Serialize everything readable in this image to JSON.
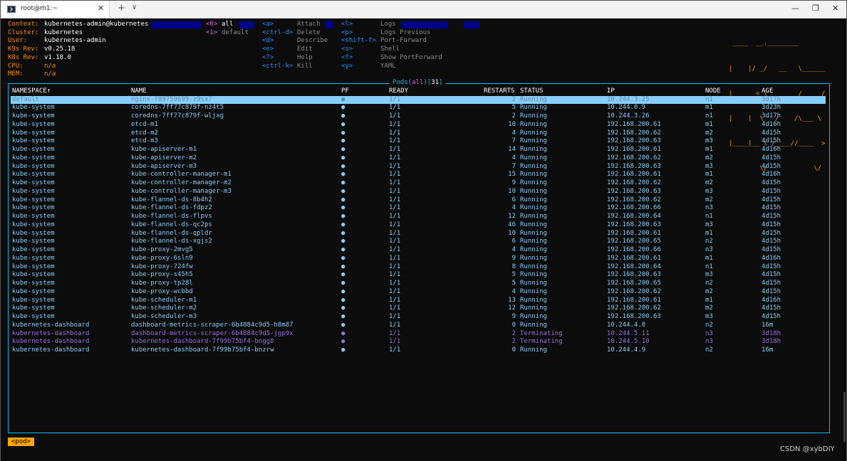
{
  "window": {
    "tab_title": "root@m1:~",
    "tab_close": "✕",
    "new_tab": "+",
    "dropdown": "∨",
    "minimize": "—",
    "maximize": "❐",
    "close": "✕"
  },
  "info": {
    "context_label": "Context:",
    "context_value": "kubernetes-admin@kubernetes",
    "cluster_label": "Cluster:",
    "cluster_value": "kubernetes",
    "user_label": "User:",
    "user_value": "kubernetes-admin",
    "k9s_label": "K9s Rev:",
    "k9s_value": "v0.25.18",
    "k8s_label": "K8s Rev:",
    "k8s_value": "v1.18.0",
    "cpu_label": "CPU:",
    "cpu_value": "n/a",
    "mem_label": "MEM:",
    "mem_value": "n/a"
  },
  "namespaces": [
    {
      "key": "<0>",
      "label": "all"
    },
    {
      "key": "<1>",
      "label": "default"
    }
  ],
  "shortcuts_col1": [
    {
      "key": "<a>",
      "label": "Attach"
    },
    {
      "key": "<ctrl-d>",
      "label": "Delete"
    },
    {
      "key": "<d>",
      "label": "Describe"
    },
    {
      "key": "<e>",
      "label": "Edit"
    },
    {
      "key": "<?>",
      "label": "Help"
    },
    {
      "key": "<ctrl-k>",
      "label": "Kill"
    }
  ],
  "shortcuts_col2": [
    {
      "key": "<l>",
      "label": "Logs"
    },
    {
      "key": "<p>",
      "label": "Logs Previous"
    },
    {
      "key": "<shift-f>",
      "label": "Port-Forward"
    },
    {
      "key": "<s>",
      "label": "Shell"
    },
    {
      "key": "<f>",
      "label": "Show PortForward"
    },
    {
      "key": "<y>",
      "label": "YAML"
    }
  ],
  "logo_lines": [
    " ____  __.________       ",
    "|    |/ _/   __   \\______",
    "|      < \\____    /  ___/",
    "|    |  \\   /    /\\___ \\ ",
    "|____|__ \\ /____//____  >",
    "        \\/            \\/ "
  ],
  "pods": {
    "title_prefix": "Pods(",
    "title_ns": "all",
    "title_mid": ")[",
    "title_count": "31",
    "title_suffix": "]",
    "columns": [
      "NAMESPACE↑",
      "NAME",
      "PF",
      "READY",
      "RESTARTS",
      "STATUS",
      "IP",
      "NODE",
      "AGE"
    ],
    "rows": [
      {
        "ns": "default",
        "name": "nginx-f89759699-z9sx7",
        "pf": "●",
        "ready": "1/1",
        "restarts": "2",
        "status": "Running",
        "ip": "10.244.3.25",
        "node": "n1",
        "age": "3d17h",
        "state": "selected"
      },
      {
        "ns": "kube-system",
        "name": "coredns-7ff77c879f-nz4t5",
        "pf": "●",
        "ready": "1/1",
        "restarts": "5",
        "status": "Running",
        "ip": "10.244.0.9",
        "node": "m1",
        "age": "3d23h",
        "state": "running"
      },
      {
        "ns": "kube-system",
        "name": "coredns-7ff77c879f-wljxg",
        "pf": "●",
        "ready": "1/1",
        "restarts": "2",
        "status": "Running",
        "ip": "10.244.3.26",
        "node": "n1",
        "age": "3d17h",
        "state": "running"
      },
      {
        "ns": "kube-system",
        "name": "etcd-m1",
        "pf": "●",
        "ready": "1/1",
        "restarts": "10",
        "status": "Running",
        "ip": "192.168.200.61",
        "node": "m1",
        "age": "4d16h",
        "state": "running"
      },
      {
        "ns": "kube-system",
        "name": "etcd-m2",
        "pf": "●",
        "ready": "1/1",
        "restarts": "4",
        "status": "Running",
        "ip": "192.168.200.62",
        "node": "m2",
        "age": "4d15h",
        "state": "running"
      },
      {
        "ns": "kube-system",
        "name": "etcd-m3",
        "pf": "●",
        "ready": "1/1",
        "restarts": "7",
        "status": "Running",
        "ip": "192.168.200.63",
        "node": "m3",
        "age": "4d15h",
        "state": "running"
      },
      {
        "ns": "kube-system",
        "name": "kube-apiserver-m1",
        "pf": "●",
        "ready": "1/1",
        "restarts": "14",
        "status": "Running",
        "ip": "192.168.200.61",
        "node": "m1",
        "age": "4d16h",
        "state": "running"
      },
      {
        "ns": "kube-system",
        "name": "kube-apiserver-m2",
        "pf": "●",
        "ready": "1/1",
        "restarts": "4",
        "status": "Running",
        "ip": "192.168.200.62",
        "node": "m2",
        "age": "4d15h",
        "state": "running"
      },
      {
        "ns": "kube-system",
        "name": "kube-apiserver-m3",
        "pf": "●",
        "ready": "1/1",
        "restarts": "7",
        "status": "Running",
        "ip": "192.168.200.63",
        "node": "m3",
        "age": "4d15h",
        "state": "running"
      },
      {
        "ns": "kube-system",
        "name": "kube-controller-manager-m1",
        "pf": "●",
        "ready": "1/1",
        "restarts": "15",
        "status": "Running",
        "ip": "192.168.200.61",
        "node": "m1",
        "age": "4d16h",
        "state": "running"
      },
      {
        "ns": "kube-system",
        "name": "kube-controller-manager-m2",
        "pf": "●",
        "ready": "1/1",
        "restarts": "9",
        "status": "Running",
        "ip": "192.168.200.62",
        "node": "m2",
        "age": "4d15h",
        "state": "running"
      },
      {
        "ns": "kube-system",
        "name": "kube-controller-manager-m3",
        "pf": "●",
        "ready": "1/1",
        "restarts": "10",
        "status": "Running",
        "ip": "192.168.200.63",
        "node": "m3",
        "age": "4d15h",
        "state": "running"
      },
      {
        "ns": "kube-system",
        "name": "kube-flannel-ds-8b4h2",
        "pf": "●",
        "ready": "1/1",
        "restarts": "6",
        "status": "Running",
        "ip": "192.168.200.62",
        "node": "m2",
        "age": "4d15h",
        "state": "running"
      },
      {
        "ns": "kube-system",
        "name": "kube-flannel-ds-fdpz2",
        "pf": "●",
        "ready": "1/1",
        "restarts": "4",
        "status": "Running",
        "ip": "192.168.200.66",
        "node": "n3",
        "age": "4d15h",
        "state": "running"
      },
      {
        "ns": "kube-system",
        "name": "kube-flannel-ds-flpvs",
        "pf": "●",
        "ready": "1/1",
        "restarts": "12",
        "status": "Running",
        "ip": "192.168.200.64",
        "node": "n1",
        "age": "4d15h",
        "state": "running"
      },
      {
        "ns": "kube-system",
        "name": "kube-flannel-ds-qc2ps",
        "pf": "●",
        "ready": "1/1",
        "restarts": "46",
        "status": "Running",
        "ip": "192.168.200.63",
        "node": "m3",
        "age": "4d15h",
        "state": "running"
      },
      {
        "ns": "kube-system",
        "name": "kube-flannel-ds-qpldr",
        "pf": "●",
        "ready": "1/1",
        "restarts": "10",
        "status": "Running",
        "ip": "192.168.200.61",
        "node": "m1",
        "age": "4d15h",
        "state": "running"
      },
      {
        "ns": "kube-system",
        "name": "kube-flannel-ds-xgjs2",
        "pf": "●",
        "ready": "1/1",
        "restarts": "6",
        "status": "Running",
        "ip": "192.168.200.65",
        "node": "n2",
        "age": "4d15h",
        "state": "running"
      },
      {
        "ns": "kube-system",
        "name": "kube-proxy-2mvg5",
        "pf": "●",
        "ready": "1/1",
        "restarts": "4",
        "status": "Running",
        "ip": "192.168.200.66",
        "node": "n3",
        "age": "4d15h",
        "state": "running"
      },
      {
        "ns": "kube-system",
        "name": "kube-proxy-6sln9",
        "pf": "●",
        "ready": "1/1",
        "restarts": "9",
        "status": "Running",
        "ip": "192.168.200.61",
        "node": "m1",
        "age": "4d16h",
        "state": "running"
      },
      {
        "ns": "kube-system",
        "name": "kube-proxy-724fw",
        "pf": "●",
        "ready": "1/1",
        "restarts": "8",
        "status": "Running",
        "ip": "192.168.200.64",
        "node": "n1",
        "age": "4d15h",
        "state": "running"
      },
      {
        "ns": "kube-system",
        "name": "kube-proxy-s45h5",
        "pf": "●",
        "ready": "1/1",
        "restarts": "5",
        "status": "Running",
        "ip": "192.168.200.63",
        "node": "m3",
        "age": "4d15h",
        "state": "running"
      },
      {
        "ns": "kube-system",
        "name": "kube-proxy-tp28l",
        "pf": "●",
        "ready": "1/1",
        "restarts": "5",
        "status": "Running",
        "ip": "192.168.200.65",
        "node": "n2",
        "age": "4d15h",
        "state": "running"
      },
      {
        "ns": "kube-system",
        "name": "kube-proxy-wcbbd",
        "pf": "●",
        "ready": "1/1",
        "restarts": "4",
        "status": "Running",
        "ip": "192.168.200.62",
        "node": "m2",
        "age": "4d15h",
        "state": "running"
      },
      {
        "ns": "kube-system",
        "name": "kube-scheduler-m1",
        "pf": "●",
        "ready": "1/1",
        "restarts": "13",
        "status": "Running",
        "ip": "192.168.200.61",
        "node": "m1",
        "age": "4d16h",
        "state": "running"
      },
      {
        "ns": "kube-system",
        "name": "kube-scheduler-m2",
        "pf": "●",
        "ready": "1/1",
        "restarts": "12",
        "status": "Running",
        "ip": "192.168.200.62",
        "node": "m2",
        "age": "4d15h",
        "state": "running"
      },
      {
        "ns": "kube-system",
        "name": "kube-scheduler-m3",
        "pf": "●",
        "ready": "1/1",
        "restarts": "9",
        "status": "Running",
        "ip": "192.168.200.63",
        "node": "m3",
        "age": "4d15h",
        "state": "running"
      },
      {
        "ns": "kubernetes-dashboard",
        "name": "dashboard-metrics-scraper-6b4884c9d5-h8m87",
        "pf": "●",
        "ready": "1/1",
        "restarts": "0",
        "status": "Running",
        "ip": "10.244.4.8",
        "node": "n2",
        "age": "16m",
        "state": "running"
      },
      {
        "ns": "kubernetes-dashboard",
        "name": "dashboard-metrics-scraper-6b4884c9d5-jgp9x",
        "pf": "●",
        "ready": "1/1",
        "restarts": "2",
        "status": "Terminating",
        "ip": "10.244.5.11",
        "node": "n3",
        "age": "3d18h",
        "state": "terminating"
      },
      {
        "ns": "kubernetes-dashboard",
        "name": "kubernetes-dashboard-7f99b75bf4-bngg8",
        "pf": "●",
        "ready": "1/1",
        "restarts": "2",
        "status": "Terminating",
        "ip": "10.244.5.10",
        "node": "n3",
        "age": "3d18h",
        "state": "terminating"
      },
      {
        "ns": "kubernetes-dashboard",
        "name": "kubernetes-dashboard-7f99b75bf4-bnzrw",
        "pf": "●",
        "ready": "1/1",
        "restarts": "0",
        "status": "Running",
        "ip": "10.244.4.9",
        "node": "n2",
        "age": "16m",
        "state": "running"
      }
    ]
  },
  "breadcrumb": "<pod>",
  "watermark": "CSDN @xybDIY",
  "colors": {
    "running": "#87cefa",
    "terminating": "#9370db",
    "selected_bg": "#87cefa",
    "selected_fg": "#5f8aa6",
    "header_key": "#ff8c00",
    "accent": "#00bfff",
    "logo": "#ff9a00"
  }
}
